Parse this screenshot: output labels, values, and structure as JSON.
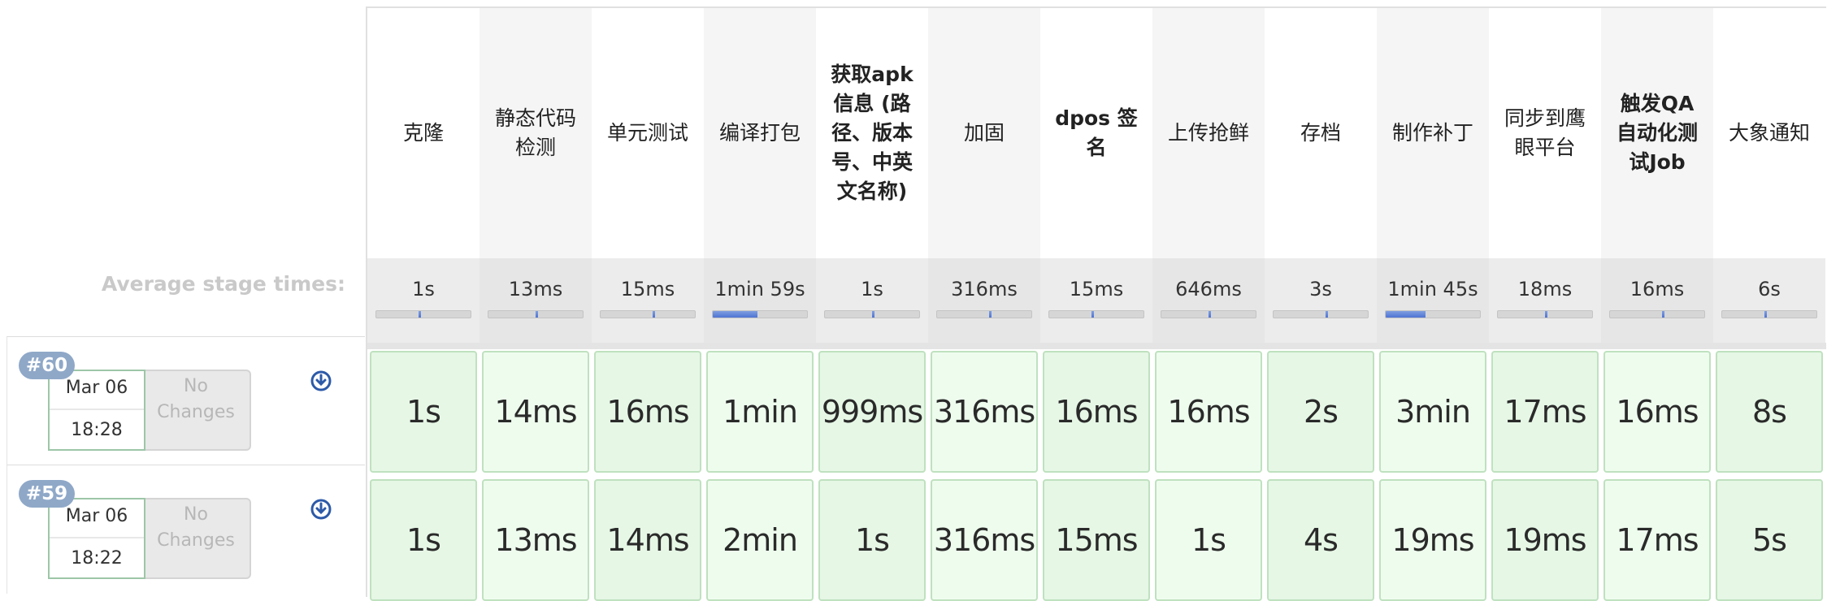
{
  "labels": {
    "avg_stage_times": "Average stage times:"
  },
  "colors": {
    "success_cell": "#e6f7e6",
    "success_cell_light": "#eefbee",
    "progress_fill": "#5b7fd6",
    "build_badge": "#8fa8c8"
  },
  "stages": [
    {
      "name": "克隆",
      "avg": "1s",
      "avg_fraction": 0.01,
      "bold": false
    },
    {
      "name": "静态代码检测",
      "avg": "13ms",
      "avg_fraction": 0.0,
      "bold": false
    },
    {
      "name": "单元测试",
      "avg": "15ms",
      "avg_fraction": 0.0,
      "bold": false
    },
    {
      "name": "编译打包",
      "avg": "1min 59s",
      "avg_fraction": 0.47,
      "bold": false
    },
    {
      "name": "获取apk 信息 (路径、版本号、中英文名称)",
      "avg": "1s",
      "avg_fraction": 0.01,
      "bold": true
    },
    {
      "name": "加固",
      "avg": "316ms",
      "avg_fraction": 0.0,
      "bold": false
    },
    {
      "name": "dpos 签名",
      "avg": "15ms",
      "avg_fraction": 0.0,
      "bold": true
    },
    {
      "name": "上传抢鲜",
      "avg": "646ms",
      "avg_fraction": 0.0,
      "bold": false
    },
    {
      "name": "存档",
      "avg": "3s",
      "avg_fraction": 0.01,
      "bold": false
    },
    {
      "name": "制作补丁",
      "avg": "1min 45s",
      "avg_fraction": 0.42,
      "bold": false
    },
    {
      "name": "同步到鹰眼平台",
      "avg": "18ms",
      "avg_fraction": 0.0,
      "bold": false
    },
    {
      "name": "触发QA自动化测试Job",
      "avg": "16ms",
      "avg_fraction": 0.0,
      "bold": true
    },
    {
      "name": "大象通知",
      "avg": "6s",
      "avg_fraction": 0.02,
      "bold": false
    }
  ],
  "builds": [
    {
      "number": "#60",
      "date": "Mar 06",
      "time": "18:28",
      "changes_line1": "No",
      "changes_line2": "Changes",
      "durations": [
        "1s",
        "14ms",
        "16ms",
        "1min",
        "999ms",
        "316ms",
        "16ms",
        "16ms",
        "2s",
        "3min",
        "17ms",
        "16ms",
        "8s"
      ]
    },
    {
      "number": "#59",
      "date": "Mar 06",
      "time": "18:22",
      "changes_line1": "No",
      "changes_line2": "Changes",
      "durations": [
        "1s",
        "13ms",
        "14ms",
        "2min",
        "1s",
        "316ms",
        "15ms",
        "1s",
        "4s",
        "19ms",
        "19ms",
        "17ms",
        "5s"
      ]
    }
  ]
}
